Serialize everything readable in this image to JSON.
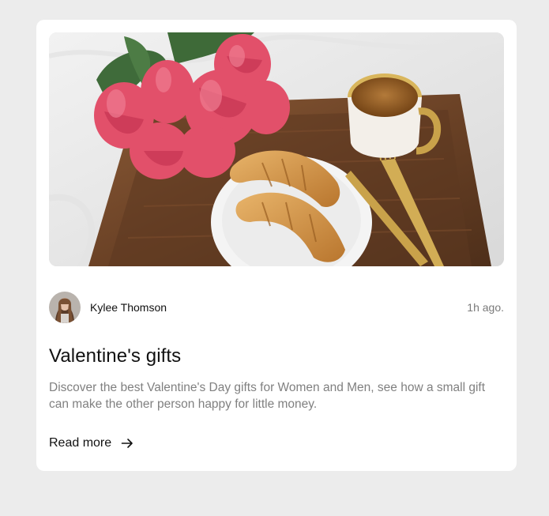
{
  "post": {
    "author": {
      "name": "Kylee Thomson",
      "avatar_icon": "avatar-photo"
    },
    "time_ago": "1h ago.",
    "title": "Valentine's gifts",
    "excerpt": "Discover the best Valentine's Day gifts for Women and Men, see how a small gift can make the other person happy for little money.",
    "read_more_label": "Read more",
    "read_more_icon": "arrow-right-icon",
    "image_icon": "breakfast-tray-photo"
  },
  "colors": {
    "page_background": "#ececec",
    "card_background": "#ffffff",
    "title": "#111111",
    "muted": "#808080"
  }
}
